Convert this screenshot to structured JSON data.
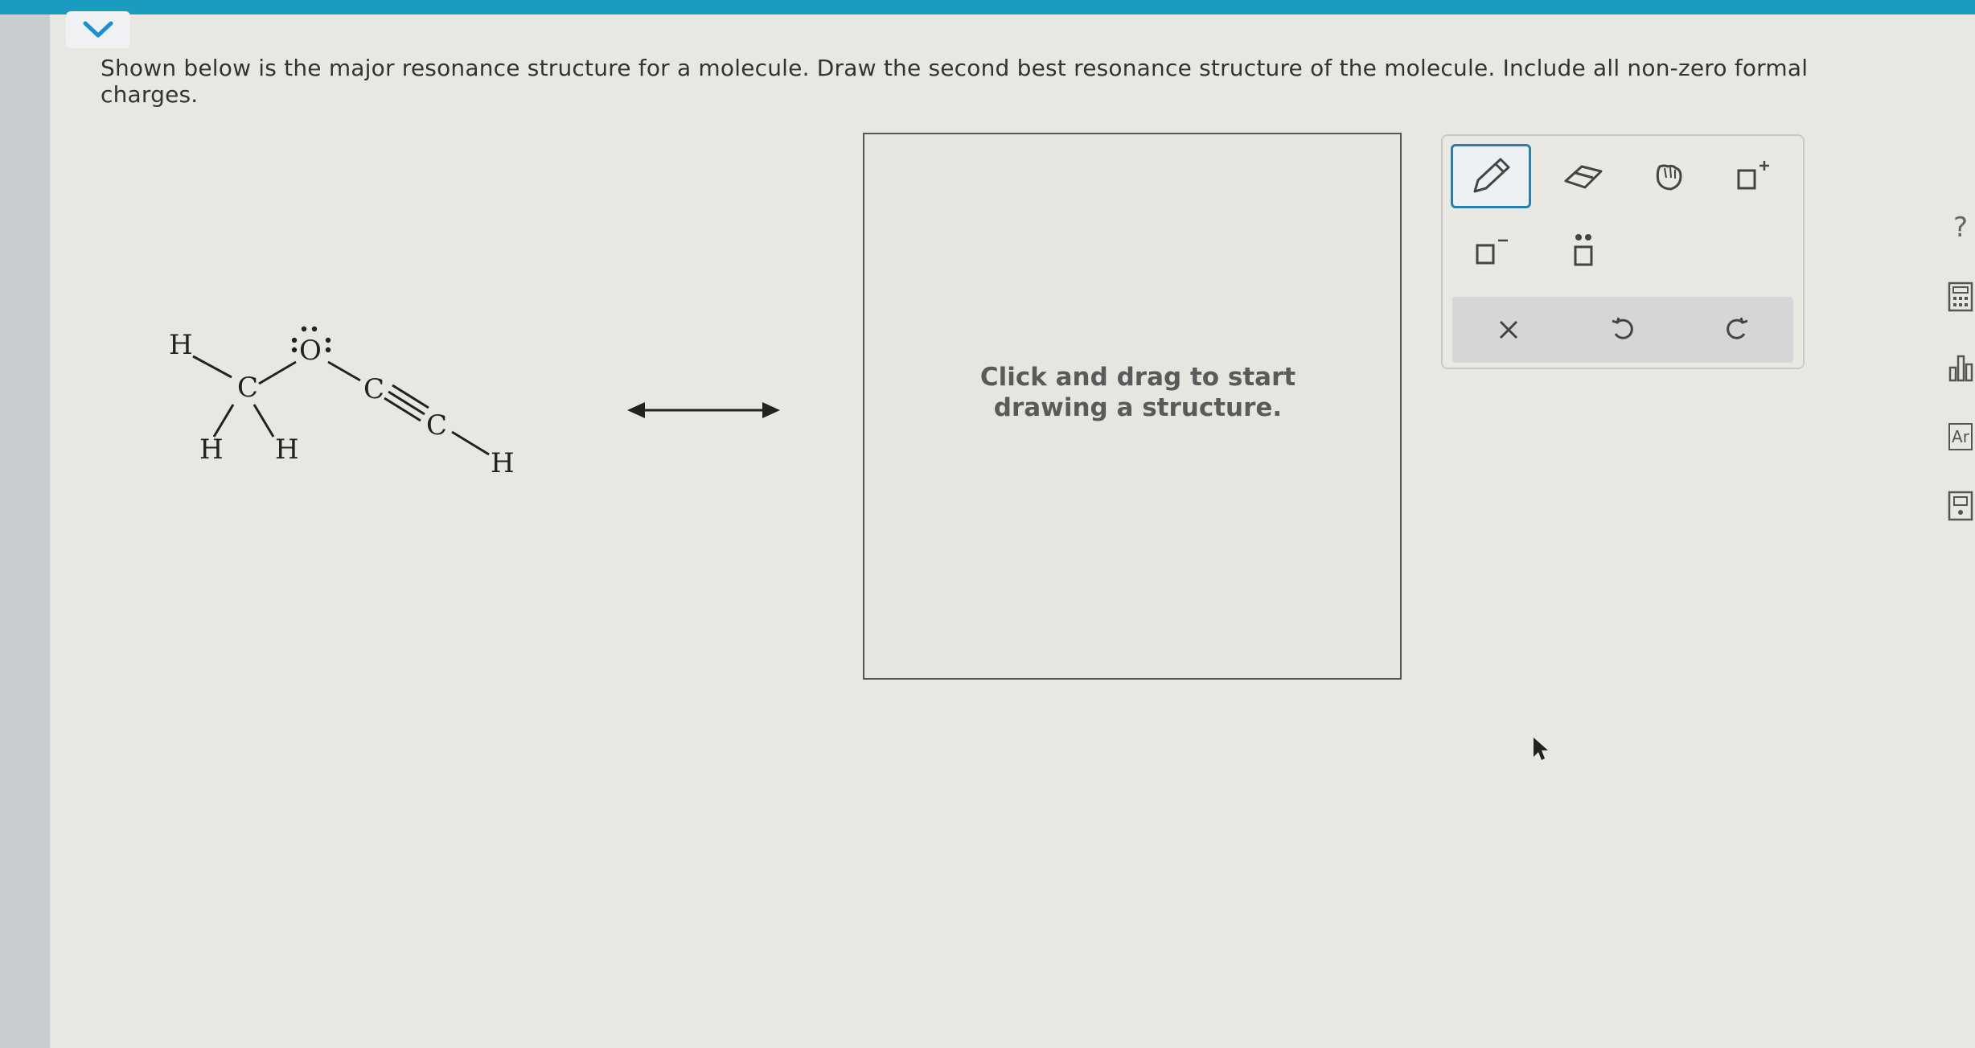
{
  "question": "Shown below is the major resonance structure for a molecule. Draw the second best resonance structure of the molecule. Include all non-zero formal charges.",
  "molecule": {
    "atoms": {
      "h_top_left": "H",
      "c_center": "C",
      "o": "O",
      "c_triple_1": "C",
      "c_triple_2": "C",
      "h_bottom_left": "H",
      "h_bottom_mid": "H",
      "h_right": "H"
    }
  },
  "canvas": {
    "hint": "Click and drag to start drawing a structure."
  },
  "toolbar": {
    "tools": [
      "pencil",
      "eraser",
      "hand",
      "positive-charge",
      "negative-charge",
      "lone-pair"
    ],
    "selected": "pencil",
    "actions": [
      "clear",
      "undo",
      "redo"
    ]
  },
  "side_panel": {
    "help": "?",
    "text_label": "Ar"
  },
  "colors": {
    "accent": "#1a9cc0",
    "selected_border": "#2a7fa8",
    "collapse_chevron": "#1a8fd6"
  }
}
